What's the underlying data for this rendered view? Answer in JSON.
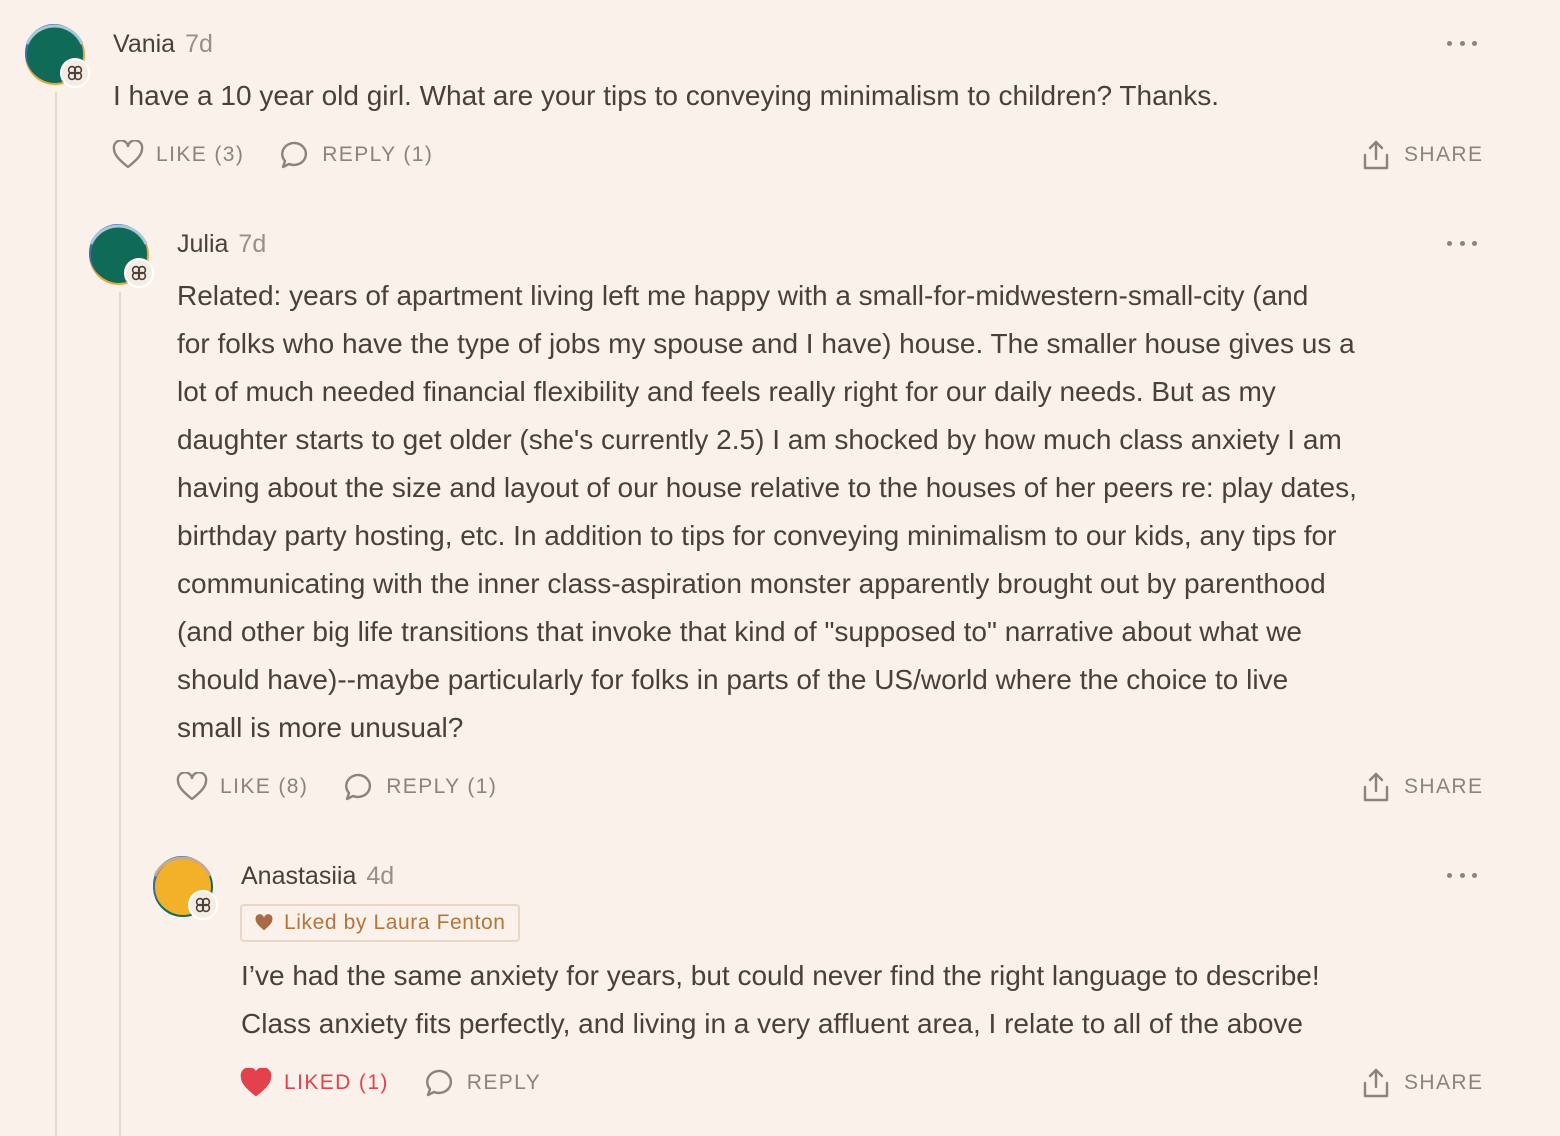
{
  "comments": [
    {
      "author": "Vania",
      "time": "7d",
      "text": "I have a 10 year old girl. What are your tips to conveying minimalism to children? Thanks.",
      "like_label": "LIKE (3)",
      "reply_label": "REPLY (1)",
      "share_label": "SHARE"
    },
    {
      "author": "Julia",
      "time": "7d",
      "text_lines": [
        "Related: years of apartment living left me happy with a small-for-midwestern-small-city (and",
        "for folks who have the type of jobs my spouse and I have) house. The smaller house gives us a",
        "lot of much needed financial flexibility and feels really right for our daily needs. But as my",
        "daughter starts to get older (she's currently 2.5) I am shocked by how much class anxiety I am",
        "having about the size and layout of our house relative to the houses of her peers re: play dates,",
        "birthday party hosting, etc. In addition to tips for conveying minimalism to our kids, any tips for",
        "communicating with the inner class-aspiration monster apparently brought out by parenthood",
        "(and other big life transitions that invoke that kind of \"supposed to\" narrative about what we",
        "should have)--maybe particularly for folks in parts of the US/world where the choice to live",
        "small is more unusual?"
      ],
      "like_label": "LIKE (8)",
      "reply_label": "REPLY (1)",
      "share_label": "SHARE"
    },
    {
      "author": "Anastasiia",
      "time": "4d",
      "liked_by": "Liked by Laura Fenton",
      "text_lines": [
        "I’ve had the same anxiety for years, but could never find the right language to describe!",
        "Class anxiety fits perfectly, and living in a very affluent area, I relate to all of the above"
      ],
      "like_label": "LIKED (1)",
      "reply_label": "REPLY",
      "share_label": "SHARE"
    }
  ],
  "colors": {
    "background": "#f9f1ea",
    "text": "#4b4038",
    "muted": "#8e8379",
    "liked": "#e3414b",
    "liked_by": "#b5753a"
  },
  "icons": [
    "heart-icon",
    "comment-icon",
    "share-icon",
    "more-icon",
    "community-badge-icon"
  ]
}
